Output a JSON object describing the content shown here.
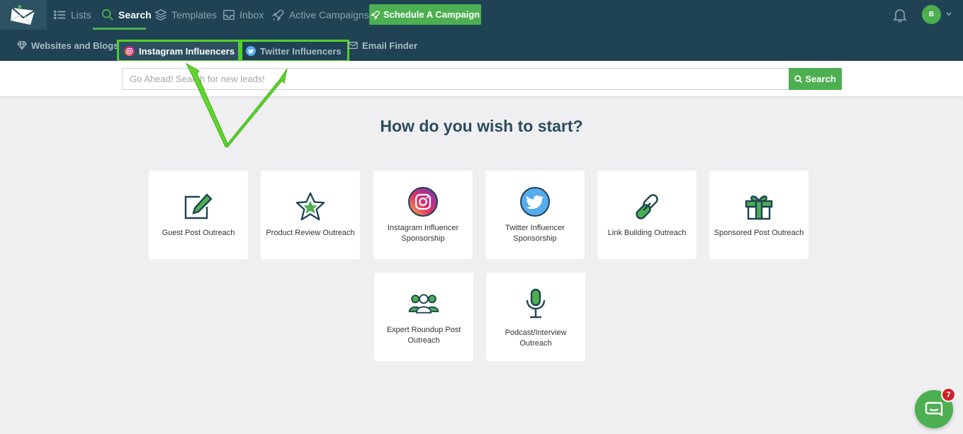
{
  "topnav": {
    "items": [
      {
        "label": "Lists",
        "icon": "list-icon"
      },
      {
        "label": "Search",
        "icon": "search-icon"
      },
      {
        "label": "Templates",
        "icon": "templates-icon"
      },
      {
        "label": "Inbox",
        "icon": "inbox-icon"
      },
      {
        "label": "Active Campaigns",
        "icon": "rocket-icon"
      }
    ],
    "schedule_label": "Schedule A Campaign",
    "avatar_initial": "B"
  },
  "subnav": {
    "items": [
      {
        "label": "Websites and Blogs",
        "icon": "diamond-icon"
      },
      {
        "label": "Instagram Influencers",
        "icon": "instagram-icon"
      },
      {
        "label": "Twitter Influencers",
        "icon": "twitter-icon"
      },
      {
        "label": "Email Finder",
        "icon": "envelope-icon"
      }
    ]
  },
  "search": {
    "placeholder": "Go Ahead! Search for new leads!",
    "button_label": "Search"
  },
  "heading": "How do you wish to start?",
  "cards": [
    {
      "label": "Guest Post Outreach",
      "icon": "pencil-edit-icon"
    },
    {
      "label": "Product Review Outreach",
      "icon": "star-icon"
    },
    {
      "label": "Instagram Influencer Sponsorship",
      "icon": "instagram-icon"
    },
    {
      "label": "Twitter Influencer Sponsorship",
      "icon": "twitter-icon"
    },
    {
      "label": "Link Building Outreach",
      "icon": "link-icon"
    },
    {
      "label": "Sponsored Post Outreach",
      "icon": "gift-icon"
    },
    {
      "label": "Expert Roundup Post Outreach",
      "icon": "users-group-icon"
    },
    {
      "label": "Podcast/Interview Outreach",
      "icon": "microphone-icon"
    }
  ],
  "chat": {
    "badge": "7"
  },
  "colors": {
    "nav_bg": "#1f4354",
    "accent_green": "#4caf50",
    "highlight_green": "#52d12a",
    "heading": "#2c4c5c",
    "page_bg": "#efeff1"
  }
}
